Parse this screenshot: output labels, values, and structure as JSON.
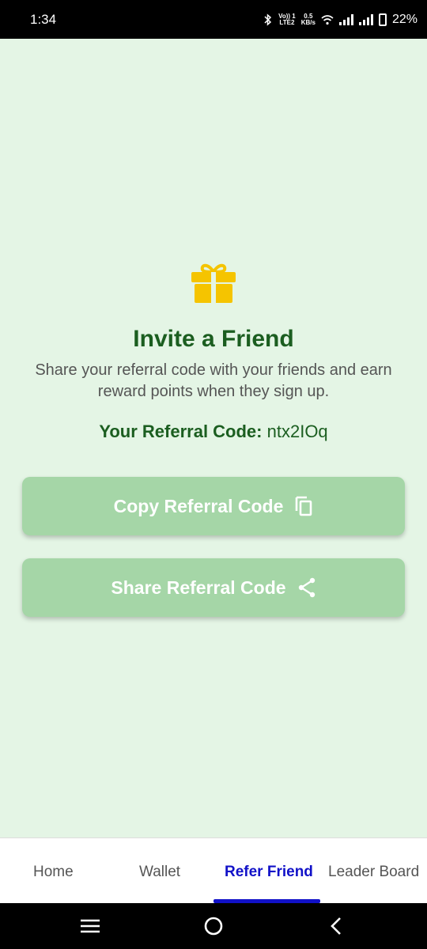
{
  "status_bar": {
    "time": "1:34",
    "network_top": "Vo)) 1",
    "network_bottom": "LTE2",
    "speed_top": "0.5",
    "speed_bottom": "KB/s",
    "battery": "22%"
  },
  "invite": {
    "icon": "gift-icon",
    "title": "Invite a Friend",
    "description": "Share your referral code with your friends and earn reward points when they sign up.",
    "code_label": "Your Referral Code:",
    "code_value": "ntx2IOq"
  },
  "buttons": {
    "copy_label": "Copy Referral Code",
    "copy_icon": "copy-icon",
    "share_label": "Share Referral Code",
    "share_icon": "share-icon"
  },
  "bottom_nav": {
    "items": [
      {
        "label": "Home",
        "active": false
      },
      {
        "label": "Wallet",
        "active": false
      },
      {
        "label": "Refer Friend",
        "active": true
      },
      {
        "label": "Leader Board",
        "active": false
      }
    ]
  },
  "colors": {
    "background": "#e4f5e5",
    "primary": "#1b5e20",
    "button": "#a5d6a7",
    "active_nav": "#1111c8",
    "gift": "#f5c400"
  }
}
